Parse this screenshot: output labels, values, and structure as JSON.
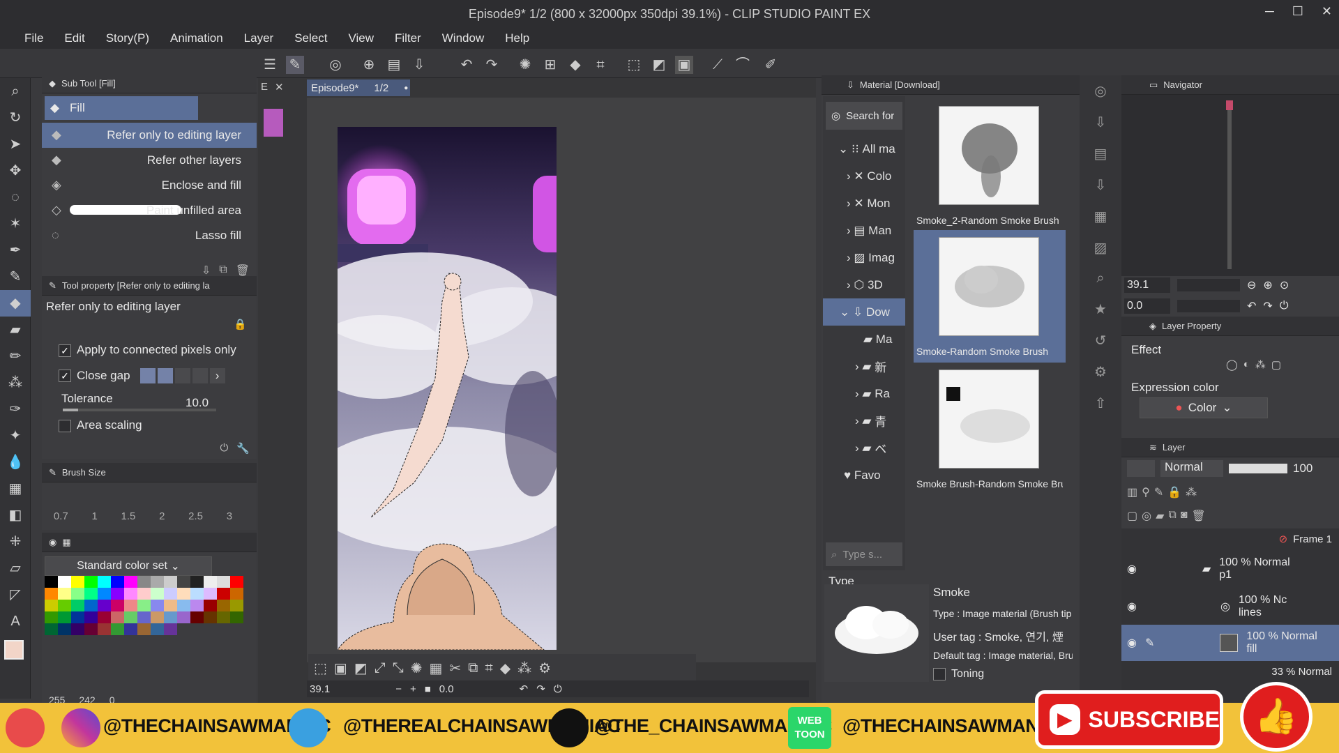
{
  "window": {
    "title": "Episode9* 1/2 (800 x 32000px 350dpi 39.1%) - CLIP STUDIO PAINT EX"
  },
  "menu": [
    "File",
    "Edit",
    "Story(P)",
    "Animation",
    "Layer",
    "Select",
    "View",
    "Filter",
    "Window",
    "Help"
  ],
  "subtool": {
    "header": "Sub Tool [Fill]",
    "group": "Fill",
    "items": [
      "Refer only to editing layer",
      "Refer other layers",
      "Enclose and fill",
      "Paint unfilled area",
      "Lasso fill"
    ]
  },
  "toolprop": {
    "header": "Tool property [Refer only to editing la",
    "name": "Refer only to editing layer",
    "apply_connected": "Apply to connected pixels only",
    "close_gap": "Close gap",
    "tolerance_label": "Tolerance",
    "tolerance_value": "10.0",
    "area_scaling": "Area scaling"
  },
  "brushsize": {
    "header": "Brush Size",
    "values": [
      "0.7",
      "1",
      "1.5",
      "2",
      "2.5",
      "3"
    ]
  },
  "colorset": {
    "name": "Standard color set",
    "rgb": [
      "255",
      "242",
      "0"
    ]
  },
  "canvas": {
    "tab_short": "E",
    "tab": "Episode9*",
    "tab_page": "1/2",
    "zoom": "39.1",
    "angle": "0.0"
  },
  "material": {
    "header": "Material [Download]",
    "search": "Search for",
    "tree": [
      "All ma",
      "Colo",
      "Mon",
      "Man",
      "Imag",
      "3D",
      "Dow",
      "Ma",
      "新",
      "Ra",
      "青",
      "ベ",
      "Favo"
    ],
    "items": [
      "Smoke_2-Random Smoke Brush",
      "Smoke-Random Smoke Brush",
      "Smoke Brush-Random Smoke Bru"
    ],
    "type_search": "Type s...",
    "type_label": "Type",
    "detail": {
      "name": "Smoke",
      "type": "Type : Image material (Brush tip sh",
      "user_tag": "User tag : Smoke, 연기, 煙",
      "default_tag": "Default tag : Image material, Brush",
      "toning": "Toning"
    }
  },
  "navigator": {
    "header": "Navigator",
    "zoom": "39.1",
    "angle": "0.0"
  },
  "layer_property": {
    "header": "Layer Property",
    "effect": "Effect",
    "expression_color": "Expression color",
    "color": "Color"
  },
  "layers": {
    "header": "Layer",
    "blend": "Normal",
    "opacity": "100",
    "rows": [
      {
        "label": "Frame 1"
      },
      {
        "label": "100 % Normal",
        "sub": "p1"
      },
      {
        "label": "100 % Nc",
        "sub": "lines"
      },
      {
        "label": "100 % Normal",
        "sub": "fill"
      },
      {
        "label": "33 % Normal"
      }
    ]
  },
  "social": {
    "items": [
      "@THECHAINSAWMANIAC",
      "@THEREALCHAINSAWMANIAC",
      "@THE_CHAINSAWMANIAC",
      "@THECHAINSAWMANIAC"
    ],
    "webtoon": [
      "WEB",
      "TOON"
    ],
    "subscribe": "SUBSCRIBE"
  },
  "colors": {
    "accent": "#5b6f98",
    "banner": "#f2c23a",
    "youtube": "#e01e1e"
  }
}
